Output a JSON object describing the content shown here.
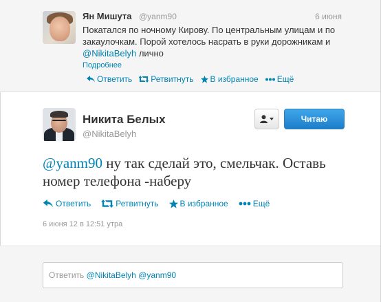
{
  "parent_tweet": {
    "name": "Ян Мишута",
    "handle": "@yanm90",
    "date": "6 июня",
    "text_parts": [
      "Покатался по ночному Кирову. По центральным улицам и по закаулочкам. Порой хотелось насрать в руки дорожникам и ",
      "@NikitaBelyh",
      " лично"
    ],
    "more_link": "Подробнее",
    "actions": {
      "reply": "Ответить",
      "retweet": "Ретвитнуть",
      "favorite": "В избранное",
      "more": "Ещё"
    }
  },
  "main_tweet": {
    "name": "Никита Белых",
    "handle": "@NikitaBelyh",
    "follow_button": "Читаю",
    "text_parts": [
      "@yanm90",
      " ну так сделай это, смельчак. Оставь номер телефона -наберу"
    ],
    "actions": {
      "reply": "Ответить",
      "retweet": "Ретвитнуть",
      "favorite": "В избранное",
      "more": "Ещё"
    },
    "timestamp": "6 июня 12 в 12:51 утра"
  },
  "reply_box": {
    "prefix": "Ответить ",
    "mentions": "@NikitaBelyh @yanm90"
  },
  "colors": {
    "link": "#0084b4",
    "follow_button": "#1d7ec9",
    "muted": "#999999"
  },
  "icons": [
    "reply-icon",
    "retweet-icon",
    "star-icon",
    "more-icon",
    "person-icon",
    "caret-down-icon"
  ]
}
